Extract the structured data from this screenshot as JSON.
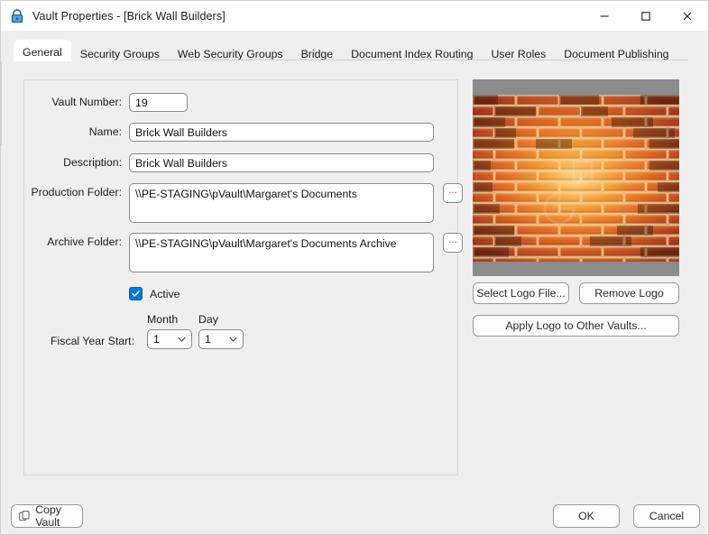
{
  "window": {
    "title": "Vault Properties - [Brick Wall Builders]",
    "lock_icon": "lock-icon",
    "controls": {
      "minimize": "minimize-icon",
      "maximize": "maximize-icon",
      "close": "close-icon"
    }
  },
  "tabs": [
    {
      "label": "General",
      "active": true
    },
    {
      "label": "Security Groups",
      "active": false
    },
    {
      "label": "Web Security Groups",
      "active": false
    },
    {
      "label": "Bridge",
      "active": false
    },
    {
      "label": "Document Index Routing",
      "active": false
    },
    {
      "label": "User Roles",
      "active": false
    },
    {
      "label": "Document Publishing",
      "active": false
    }
  ],
  "form": {
    "vault_number": {
      "label": "Vault Number:",
      "value": "19"
    },
    "name": {
      "label": "Name:",
      "value": "Brick Wall Builders"
    },
    "description": {
      "label": "Description:",
      "value": "Brick Wall Builders"
    },
    "production_folder": {
      "label": "Production Folder:",
      "value": "\\\\PE-STAGING\\pVault\\Margaret's Documents",
      "browse_label": "..."
    },
    "archive_folder": {
      "label": "Archive Folder:",
      "value": "\\\\PE-STAGING\\pVault\\Margaret's Documents Archive",
      "browse_label": "..."
    },
    "active": {
      "label": "Active",
      "checked": true
    },
    "fiscal_year": {
      "label": "Fiscal Year Start:",
      "month_header": "Month",
      "day_header": "Day",
      "month_value": "1",
      "day_value": "1",
      "chevron_icon": "chevron-down-icon"
    }
  },
  "logo": {
    "image_alt": "brick-wall-logo",
    "select_button": "Select Logo File...",
    "remove_button": "Remove Logo",
    "apply_button": "Apply Logo to Other Vaults..."
  },
  "footer": {
    "copy_vault": "Copy Vault",
    "copy_icon": "copy-icon",
    "ok": "OK",
    "cancel": "Cancel"
  },
  "colors": {
    "accent": "#0078d4",
    "window_bg": "#efefef",
    "titlebar_bg": "#ffffff",
    "logo_bg": "#8c8c8c",
    "brick_light": "#f7a13a",
    "brick_dark": "#9e2d12"
  }
}
